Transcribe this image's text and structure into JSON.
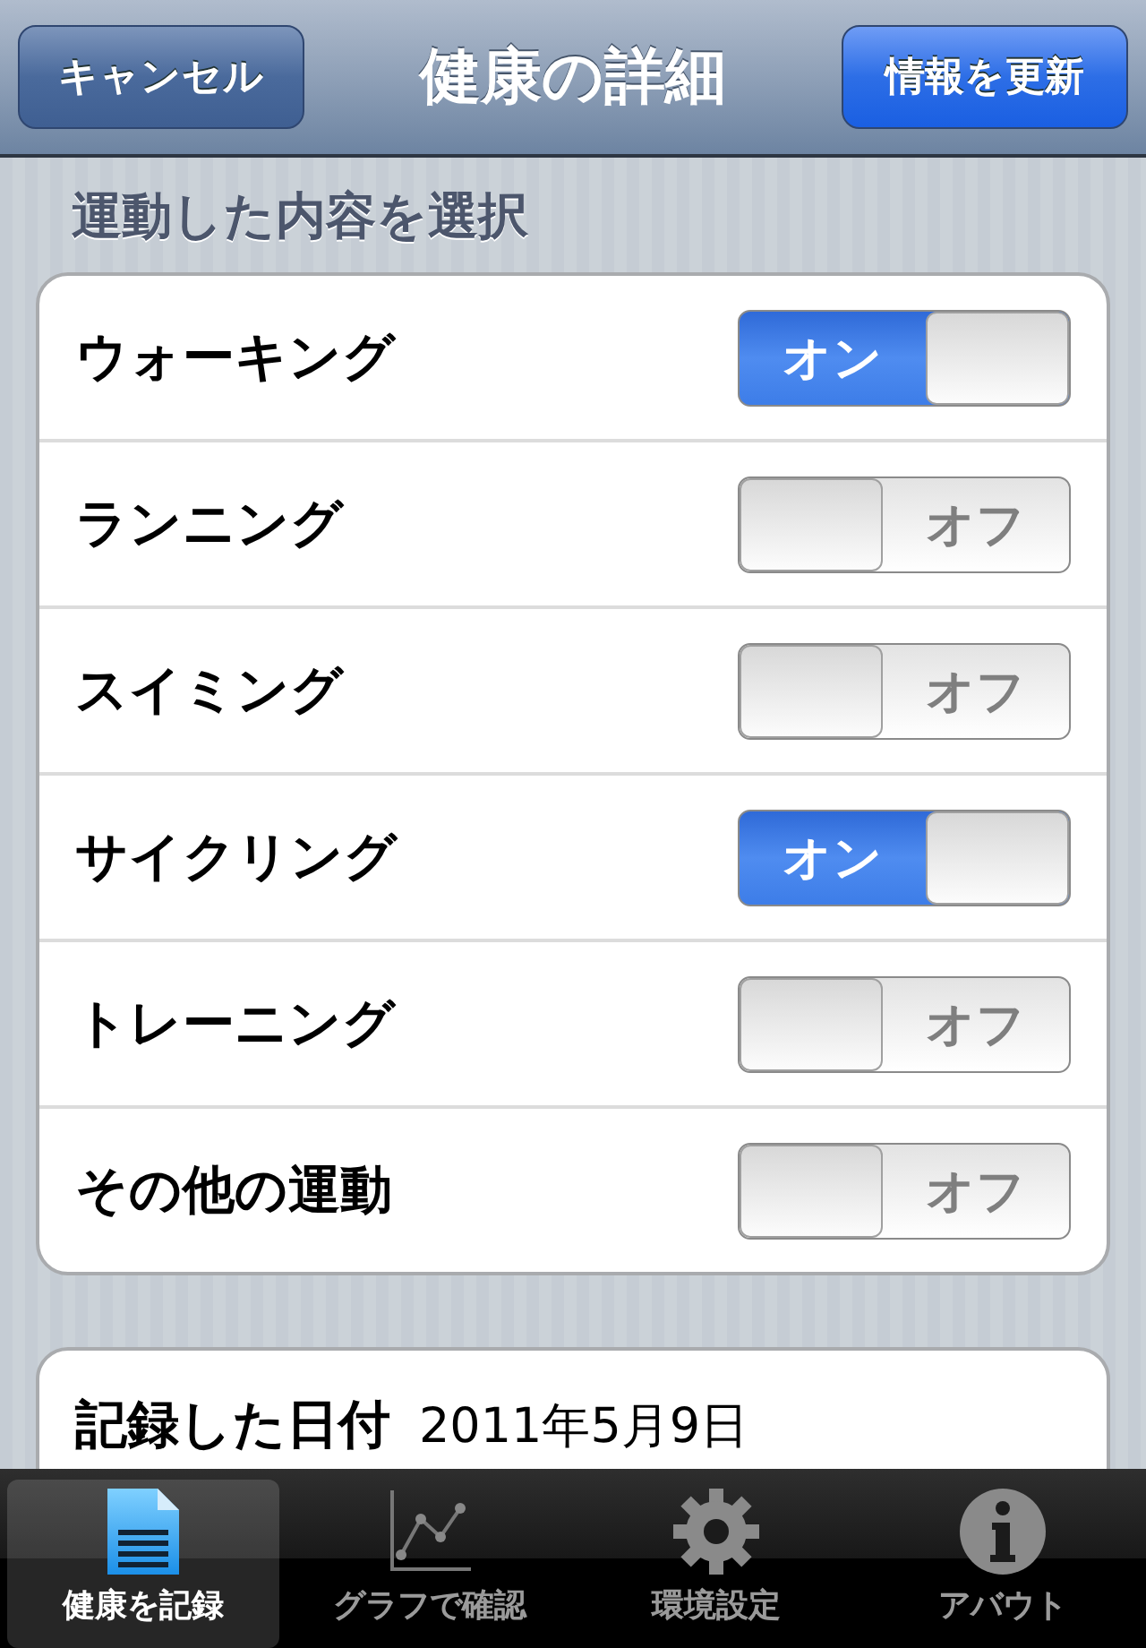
{
  "nav_bar": {
    "title": "健康の詳細",
    "left_button": "キャンセル",
    "right_button": "情報を更新"
  },
  "section_header": "運動した内容を選択",
  "exercises": [
    {
      "label": "ウォーキング",
      "on": true,
      "switch_text": "オン"
    },
    {
      "label": "ランニング",
      "on": false,
      "switch_text": "オフ"
    },
    {
      "label": "スイミング",
      "on": false,
      "switch_text": "オフ"
    },
    {
      "label": "サイクリング",
      "on": true,
      "switch_text": "オン"
    },
    {
      "label": "トレーニング",
      "on": false,
      "switch_text": "オフ"
    },
    {
      "label": "その他の運動",
      "on": false,
      "switch_text": "オフ"
    }
  ],
  "record_date": {
    "label": "記録した日付",
    "value": "2011年5月9日"
  },
  "tab_bar": [
    {
      "label": "健康を記録",
      "kind": "document",
      "selected": true
    },
    {
      "label": "グラフで確認",
      "kind": "graph",
      "selected": false
    },
    {
      "label": "環境設定",
      "kind": "gear",
      "selected": false
    },
    {
      "label": "アバウト",
      "kind": "info",
      "selected": false
    }
  ]
}
